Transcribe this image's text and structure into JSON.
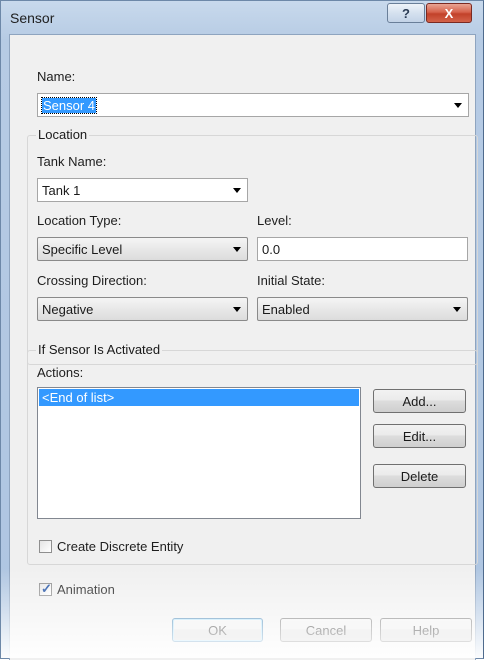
{
  "window": {
    "title": "Sensor",
    "help_glyph": "?",
    "close_glyph": "X"
  },
  "name": {
    "label": "Name:",
    "value": "Sensor 4"
  },
  "location": {
    "group_label": "Location",
    "tank_name_label": "Tank Name:",
    "tank_name_value": "Tank 1",
    "location_type_label": "Location Type:",
    "location_type_value": "Specific Level",
    "level_label": "Level:",
    "level_value": "0.0",
    "crossing_direction_label": "Crossing Direction:",
    "crossing_direction_value": "Negative",
    "initial_state_label": "Initial State:",
    "initial_state_value": "Enabled"
  },
  "activation": {
    "group_label": "If Sensor Is Activated",
    "actions_label": "Actions:",
    "actions": [
      "<End of list>"
    ],
    "add_label": "Add...",
    "edit_label": "Edit...",
    "delete_label": "Delete",
    "create_discrete_entity_label": "Create Discrete Entity",
    "create_discrete_entity_checked": false
  },
  "animation": {
    "label": "Animation",
    "checked": true
  },
  "buttons": {
    "ok": "OK",
    "cancel": "Cancel",
    "help": "Help"
  }
}
